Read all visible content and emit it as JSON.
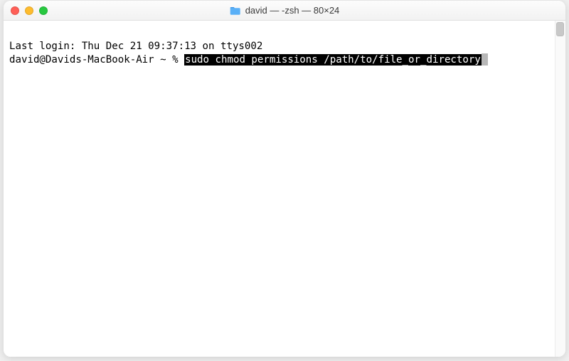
{
  "window": {
    "title": "david — -zsh — 80×24"
  },
  "terminal": {
    "last_login": "Last login: Thu Dec 21 09:37:13 on ttys002",
    "prompt": "david@Davids-MacBook-Air ~ % ",
    "command_highlight": "sudo chmod permissions /path/to/file_or_directory"
  },
  "icons": {
    "folder": "folder-icon",
    "close": "close-icon",
    "minimize": "minimize-icon",
    "zoom": "zoom-icon"
  }
}
